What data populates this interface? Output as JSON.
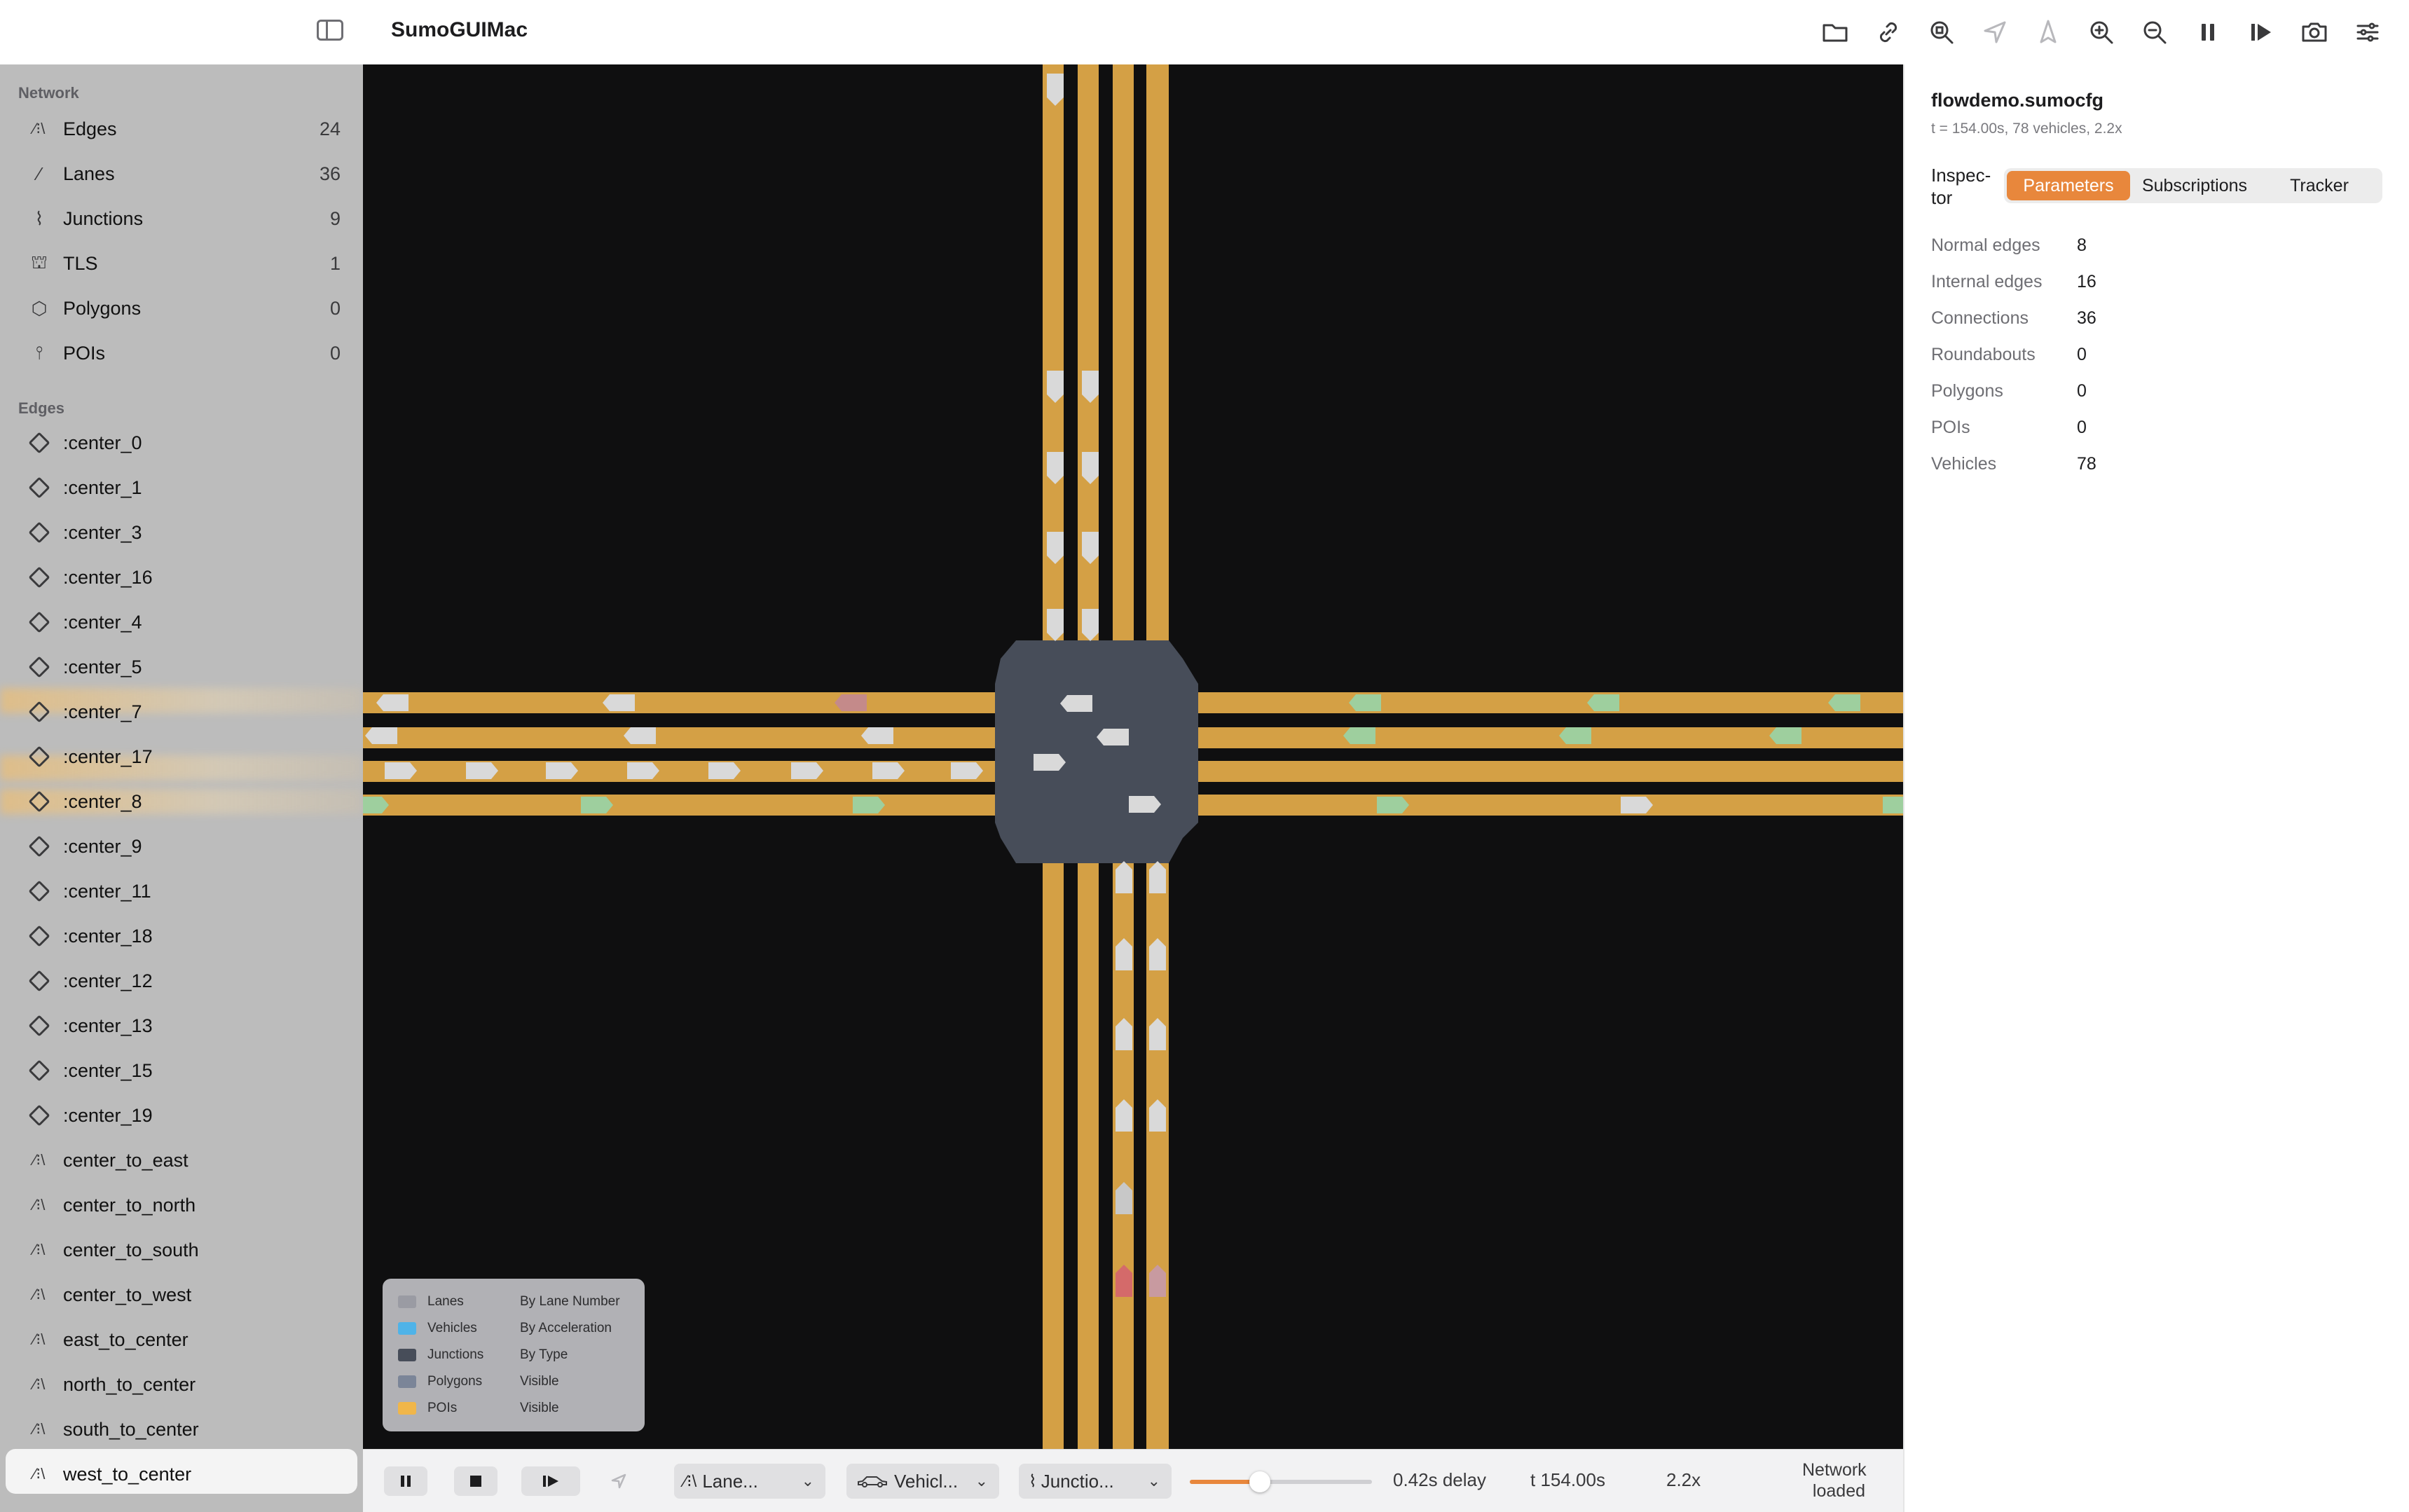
{
  "app": {
    "title": "SumoGUIMac"
  },
  "sidebar": {
    "network_title": "Network",
    "network_items": [
      {
        "label": "Edges",
        "count": "24",
        "icon": "road-icon"
      },
      {
        "label": "Lanes",
        "count": "36",
        "icon": "lane-icon"
      },
      {
        "label": "Junctions",
        "count": "9",
        "icon": "junction-icon"
      },
      {
        "label": "TLS",
        "count": "1",
        "icon": "traffic-light-icon"
      },
      {
        "label": "Polygons",
        "count": "0",
        "icon": "hexagon-icon"
      },
      {
        "label": "POIs",
        "count": "0",
        "icon": "pin-icon"
      }
    ],
    "edges_title": "Edges",
    "edge_items": [
      {
        "label": ":center_0",
        "icon": "diamond-icon"
      },
      {
        "label": ":center_1",
        "icon": "diamond-icon"
      },
      {
        "label": ":center_3",
        "icon": "diamond-icon"
      },
      {
        "label": ":center_16",
        "icon": "diamond-icon"
      },
      {
        "label": ":center_4",
        "icon": "diamond-icon"
      },
      {
        "label": ":center_5",
        "icon": "diamond-icon"
      },
      {
        "label": ":center_7",
        "icon": "diamond-icon"
      },
      {
        "label": ":center_17",
        "icon": "diamond-icon"
      },
      {
        "label": ":center_8",
        "icon": "diamond-icon"
      },
      {
        "label": ":center_9",
        "icon": "diamond-icon"
      },
      {
        "label": ":center_11",
        "icon": "diamond-icon"
      },
      {
        "label": ":center_18",
        "icon": "diamond-icon"
      },
      {
        "label": ":center_12",
        "icon": "diamond-icon"
      },
      {
        "label": ":center_13",
        "icon": "diamond-icon"
      },
      {
        "label": ":center_15",
        "icon": "diamond-icon"
      },
      {
        "label": ":center_19",
        "icon": "diamond-icon"
      },
      {
        "label": "center_to_east",
        "icon": "road-icon"
      },
      {
        "label": "center_to_north",
        "icon": "road-icon"
      },
      {
        "label": "center_to_south",
        "icon": "road-icon"
      },
      {
        "label": "center_to_west",
        "icon": "road-icon"
      },
      {
        "label": "east_to_center",
        "icon": "road-icon"
      },
      {
        "label": "north_to_center",
        "icon": "road-icon"
      },
      {
        "label": "south_to_center",
        "icon": "road-icon"
      },
      {
        "label": "west_to_center",
        "icon": "road-icon"
      }
    ],
    "selected": "west_to_center"
  },
  "toolbar": {
    "icons": [
      "folder-icon",
      "link-icon",
      "zoom-fit-icon",
      "locate-icon",
      "compass-icon",
      "zoom-in-icon",
      "zoom-out-icon",
      "pause-icon",
      "step-icon",
      "camera-icon",
      "sliders-icon"
    ]
  },
  "legend": {
    "rows": [
      {
        "name": "Lanes",
        "value": "By Lane Number",
        "color": "#9a9ba3"
      },
      {
        "name": "Vehicles",
        "value": "By Acceleration",
        "color": "#4fb3e8"
      },
      {
        "name": "Junctions",
        "value": "By Type",
        "color": "#474d59"
      },
      {
        "name": "Polygons",
        "value": "Visible",
        "color": "#7b8598"
      },
      {
        "name": "POIs",
        "value": "Visible",
        "color": "#f0b64a"
      }
    ]
  },
  "inspector": {
    "file": "flowdemo.sumocfg",
    "status": "t = 154.00s, 78 vehicles, 2.2x",
    "label": "Inspec-tor",
    "tabs": [
      "Parameters",
      "Subscriptions",
      "Tracker"
    ],
    "active_tab": "Parameters",
    "rows": [
      {
        "key": "Normal edges",
        "value": "8"
      },
      {
        "key": "Internal edges",
        "value": "16"
      },
      {
        "key": "Connections",
        "value": "36"
      },
      {
        "key": "Roundabouts",
        "value": "0"
      },
      {
        "key": "Polygons",
        "value": "0"
      },
      {
        "key": "POIs",
        "value": "0"
      },
      {
        "key": "Vehicles",
        "value": "78"
      }
    ]
  },
  "bottombar": {
    "lane_select": "Lane...",
    "vehicle_select": "Vehicl...",
    "junction_select": "Junctio...",
    "delay_fraction": 0.42,
    "delay_text": "0.42s delay",
    "time_text": "t 154.00s",
    "speed_text": "2.2x",
    "status_text": "Network loaded"
  },
  "colors": {
    "road": "#d4a045",
    "junction": "#474d59",
    "background": "#0f0f10",
    "accent": "#e8873c",
    "vehicle_default": "#d9d9d9",
    "vehicle_accel": "#9ecf9e",
    "vehicle_brake": "#d46a6a"
  }
}
